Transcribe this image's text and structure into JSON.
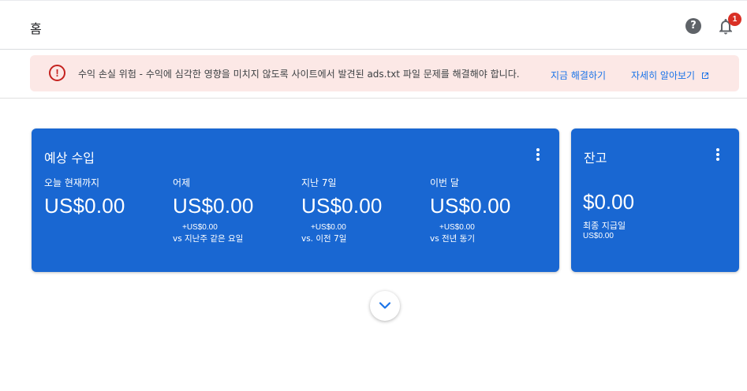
{
  "header": {
    "title": "홈",
    "help_icon_glyph": "?",
    "notification_count": "1"
  },
  "alert": {
    "message": "수익 손실 위험 - 수익에 심각한 영향을 미치지 않도록 사이트에서 발견된 ads.txt 파일 문제를 해결해야 합니다.",
    "fix_label": "지금 해결하기",
    "learn_label": "자세히 알아보기",
    "icon_glyph": "!"
  },
  "earnings": {
    "title": "예상 수입",
    "metrics": [
      {
        "label": "오늘 현재까지",
        "value": "US$0.00",
        "delta": "",
        "compare": ""
      },
      {
        "label": "어제",
        "value": "US$0.00",
        "delta": "+US$0.00",
        "compare": "vs 지난주 같은 요일"
      },
      {
        "label": "지난 7일",
        "value": "US$0.00",
        "delta": "+US$0.00",
        "compare": "vs. 이전 7일"
      },
      {
        "label": "이번 달",
        "value": "US$0.00",
        "delta": "+US$0.00",
        "compare": "vs 전년 동기"
      }
    ]
  },
  "balance": {
    "title": "잔고",
    "value": "$0.00",
    "last_payment_label": "최종 지급일",
    "last_payment_value": "US$0.00"
  },
  "colors": {
    "card_blue": "#1967d2",
    "link_blue": "#1a73e8",
    "alert_bg": "#fce8e6",
    "alert_red": "#c5221f",
    "badge_red": "#d93025"
  },
  "icons": [
    "help-icon",
    "bell-icon",
    "error-icon",
    "external-link-icon",
    "more-vert-icon",
    "chevron-down-icon"
  ]
}
